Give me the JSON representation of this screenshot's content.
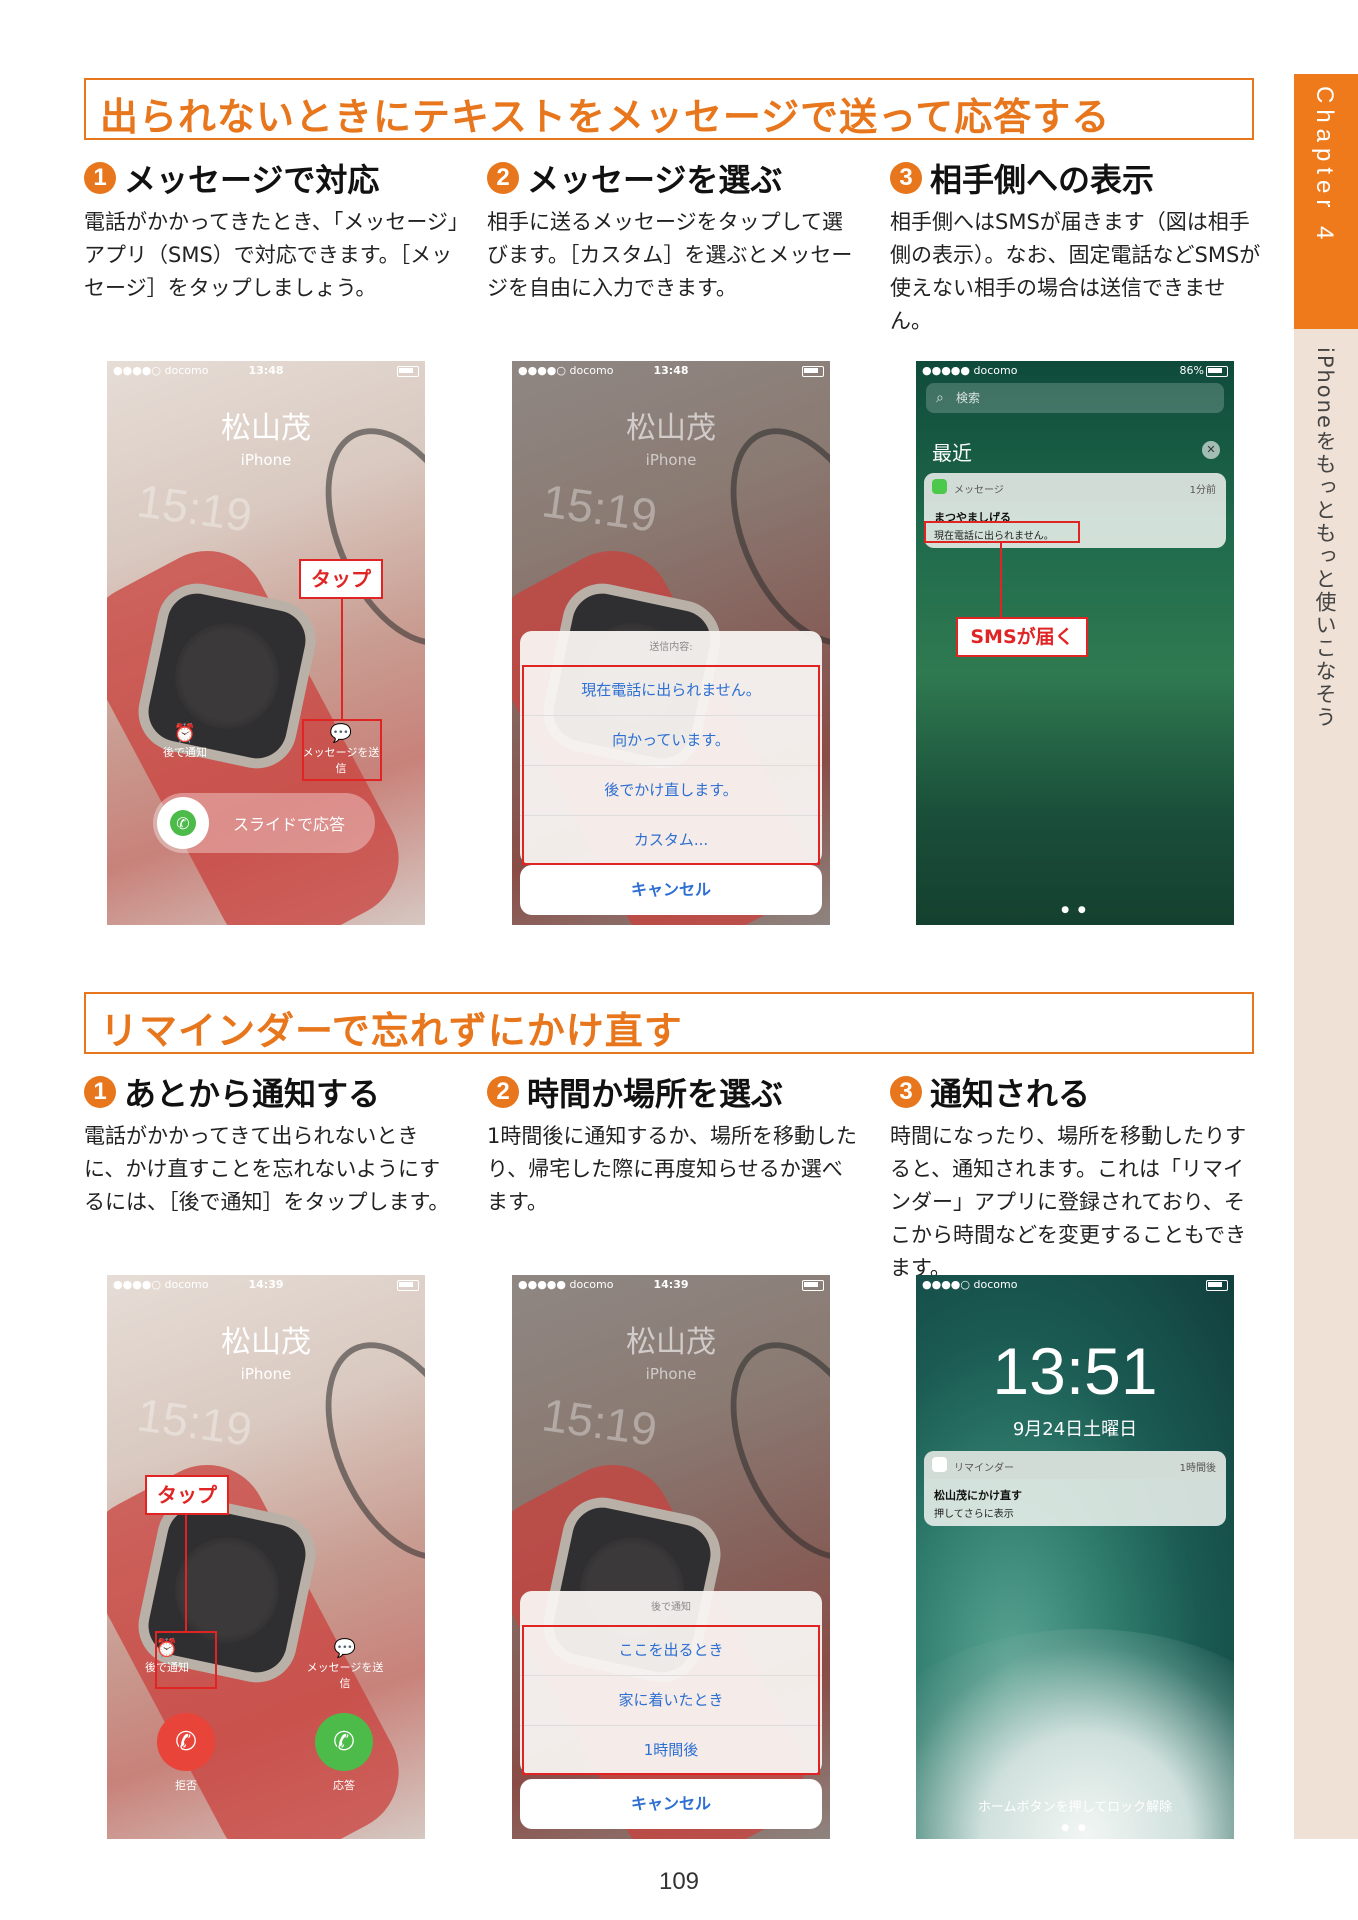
{
  "chapter": {
    "label": "Chapter 4",
    "side_title": "iPhoneをもっともっと使いこなそう"
  },
  "section1": {
    "title": "出られないときにテキストをメッセージで送って応答する",
    "steps": [
      {
        "num": "1",
        "title": "メッセージで対応",
        "body": "電話がかかってきたとき、「メッセージ」アプリ（SMS）で対応できます。［メッセージ］をタップしましょう。"
      },
      {
        "num": "2",
        "title": "メッセージを選ぶ",
        "body": "相手に送るメッセージをタップして選びます。［カスタム］を選ぶとメッセージを自由に入力できます。"
      },
      {
        "num": "3",
        "title": "相手側への表示",
        "body": "相手側へはSMSが届きます（図は相手側の表示）。なお、固定電話などSMSが使えない相手の場合は送信できません。"
      }
    ],
    "phone1": {
      "carrier": "●●●●○ docomo",
      "time": "13:48",
      "caller": "松山茂",
      "caller_sub": "iPhone",
      "remind_label": "後で通知",
      "message_label": "メッセージを送信",
      "slide_label": "スライドで応答",
      "tap_label": "タップ"
    },
    "phone2": {
      "carrier": "●●●●○ docomo",
      "time": "13:48",
      "caller": "松山茂",
      "caller_sub": "iPhone",
      "sheet_header": "送信内容:",
      "options": [
        "現在電話に出られません。",
        "向かっています。",
        "後でかけ直します。",
        "カスタム..."
      ],
      "cancel": "キャンセル"
    },
    "phone3": {
      "carrier": "●●●●● docomo",
      "battery_pct": "86%",
      "search_placeholder": "検索",
      "recent": "最近",
      "notif_app": "メッセージ",
      "notif_time": "1分前",
      "notif_sender": "まつやましげる",
      "notif_message": "現在電話に出られません。",
      "callout": "SMSが届く"
    }
  },
  "section2": {
    "title": "リマインダーで忘れずにかけ直す",
    "steps": [
      {
        "num": "1",
        "title": "あとから通知する",
        "body": "電話がかかってきて出られないときに、かけ直すことを忘れないようにするには、［後で通知］をタップします。"
      },
      {
        "num": "2",
        "title": "時間か場所を選ぶ",
        "body": "1時間後に通知するか、場所を移動したり、帰宅した際に再度知らせるか選べます。"
      },
      {
        "num": "3",
        "title": "通知される",
        "body": "時間になったり、場所を移動したりすると、通知されます。これは「リマインダー」アプリに登録されており、そこから時間などを変更することもできます。"
      }
    ],
    "phone4": {
      "carrier": "●●●●○ docomo",
      "time": "14:39",
      "caller": "松山茂",
      "caller_sub": "iPhone",
      "remind_label": "後で通知",
      "message_label": "メッセージを送信",
      "decline_label": "拒否",
      "accept_label": "応答",
      "tap_label": "タップ"
    },
    "phone5": {
      "carrier": "●●●●● docomo",
      "time": "14:39",
      "caller": "松山茂",
      "caller_sub": "iPhone",
      "sheet_header": "後で通知",
      "options": [
        "ここを出るとき",
        "家に着いたとき",
        "1時間後"
      ],
      "cancel": "キャンセル"
    },
    "phone6": {
      "carrier": "●●●●○ docomo",
      "time": "13:51",
      "date": "9月24日土曜日",
      "notif_app": "リマインダー",
      "notif_time": "1時間後",
      "notif_title": "松山茂にかけ直す",
      "notif_sub": "押してさらに表示",
      "home_text": "ホームボタンを押してロック解除"
    }
  },
  "page_number": "109"
}
